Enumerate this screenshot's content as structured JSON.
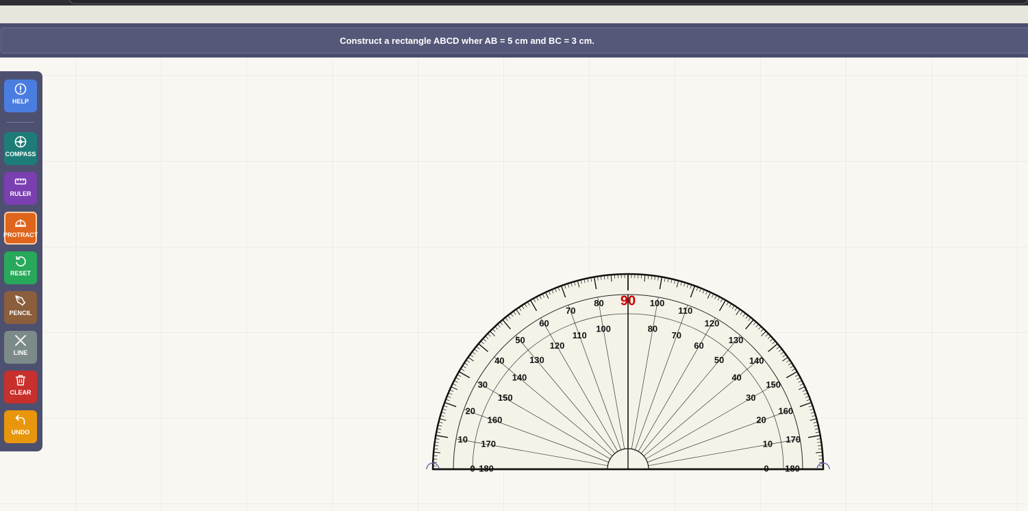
{
  "task": {
    "instruction": "Construct a rectangle ABCD wher AB = 5 cm and BC = 3 cm."
  },
  "toolbar": {
    "tools": [
      {
        "label": "HELP",
        "icon": "info-icon",
        "color": "#4a7de0"
      },
      {
        "label": "COMPASS",
        "icon": "compass-icon",
        "color": "#1e7c78"
      },
      {
        "label": "RULER",
        "icon": "ruler-icon",
        "color": "#7a3fb0"
      },
      {
        "label": "PROTRACT",
        "icon": "protractor-icon",
        "color": "#e0641c",
        "active": true
      },
      {
        "label": "RESET",
        "icon": "reset-icon",
        "color": "#27a85a"
      },
      {
        "label": "PENCIL",
        "icon": "pencil-icon",
        "color": "#8b5e3c"
      },
      {
        "label": "LINE",
        "icon": "line-icon",
        "color": "#7c8a8a"
      },
      {
        "label": "CLEAR",
        "icon": "trash-icon",
        "color": "#c8302c"
      },
      {
        "label": "UNDO",
        "icon": "undo-icon",
        "color": "#e8960c"
      }
    ]
  },
  "protractor": {
    "outer_scale": [
      "0",
      "10",
      "20",
      "30",
      "40",
      "50",
      "60",
      "70",
      "80",
      "90",
      "100",
      "110",
      "120",
      "130",
      "140",
      "150",
      "160",
      "170",
      "180"
    ],
    "inner_scale": [
      "180",
      "170",
      "160",
      "150",
      "140",
      "130",
      "120",
      "110",
      "100",
      "80",
      "70",
      "60",
      "50",
      "40",
      "30",
      "20",
      "10",
      "0"
    ],
    "highlight_label": "90",
    "highlight_color": "#cc0000"
  }
}
